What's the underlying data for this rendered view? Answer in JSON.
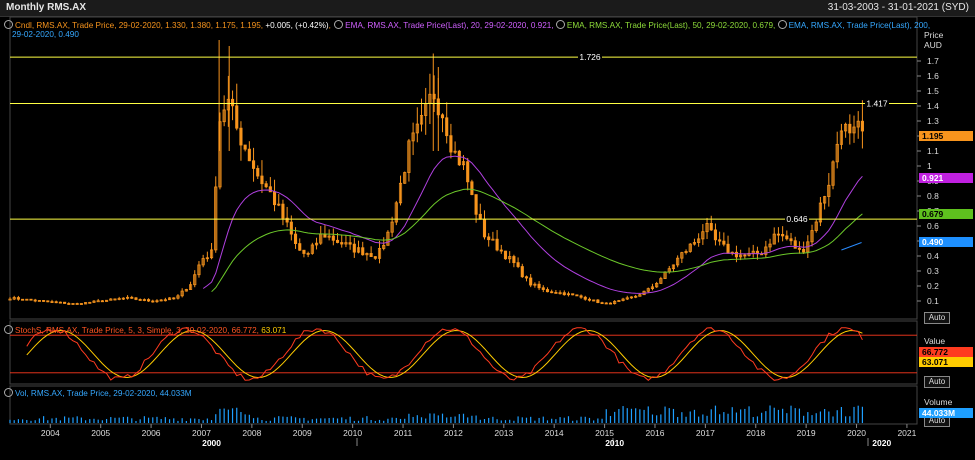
{
  "header": {
    "title": "Monthly RMS.AX",
    "date_range": "31-03-2003 - 31-01-2021 (SYD)"
  },
  "legends": {
    "cndl": {
      "icon": "gear-dot-icon",
      "parts": [
        {
          "text": "Cndl, RMS.AX, Trade Price, 29-02-2020, 1.330, 1.380, 1.175, 1.195, ",
          "color": "#f7941d"
        },
        {
          "text": "+0.005, (+0.42%)",
          "color": "#ffffff"
        },
        {
          "text": ", ",
          "color": "#f7941d"
        }
      ]
    },
    "ema20": {
      "text": "EMA, RMS.AX, Trade Price(Last),  20, 29-02-2020, 0.921, ",
      "color": "#d060ff"
    },
    "ema50": {
      "text": "EMA, RMS.AX, Trade Price(Last),  50, 29-02-2020, 0.679, ",
      "color": "#8edc3a"
    },
    "ema200_a": {
      "text": "EMA, RMS.AX, Trade Price(Last),  200,",
      "color": "#35a8ff"
    },
    "ema200_b": {
      "text": "29-02-2020, 0.490",
      "color": "#35a8ff"
    },
    "stoch": {
      "text": "StochS, RMS.AX, Trade Price,  5, 3, Simple, 3, 29-02-2020, 66.772, ",
      "color": "#ff5522",
      "value2": "63.071",
      "value2_color": "#ffcc00"
    },
    "vol": {
      "text": "Vol, RMS.AX, Trade Price, 29-02-2020, 44.033M",
      "color": "#35a8ff"
    }
  },
  "axes": {
    "price_head": "Price",
    "price_unit": "AUD",
    "stoch_head": "Value",
    "vol_head": "Volume",
    "auto": "Auto",
    "price_ticks": [
      "1.7",
      "1.6",
      "1.5",
      "1.4",
      "1.3",
      "1.2",
      "1.1",
      "1",
      "0.9",
      "0.8",
      "0.7",
      "0.6",
      "0.5",
      "0.4",
      "0.3",
      "0.2",
      "0.1"
    ],
    "years": [
      "2004",
      "2005",
      "2006",
      "2007",
      "2008",
      "2009",
      "2010",
      "2011",
      "2012",
      "2013",
      "2014",
      "2015",
      "2016",
      "2017",
      "2018",
      "2019",
      "2020",
      "2021"
    ],
    "decades": [
      "2000",
      "2010",
      "2020"
    ]
  },
  "tags": {
    "last_price": {
      "text": "1.195",
      "color": "#f7941d"
    },
    "ema20": {
      "text": "0.921",
      "color": "#c020e0"
    },
    "ema50": {
      "text": "0.679",
      "color": "#5ec01e"
    },
    "ema200": {
      "text": "0.490",
      "color": "#1e90ff"
    },
    "stoch_k": {
      "text": "66.772",
      "color": "#ff3b1f"
    },
    "stoch_d": {
      "text": "63.071",
      "color": "#ffcc00"
    },
    "volume": {
      "text": "44.033M",
      "color": "#1e9fff"
    }
  },
  "levels": [
    {
      "text": "1.726",
      "value": 1.726
    },
    {
      "text": "1.417",
      "value": 1.417
    },
    {
      "text": "0.646",
      "value": 0.646
    }
  ],
  "colors": {
    "candle": "#f7941d",
    "ema20": "#b040e0",
    "ema50": "#6cc82a",
    "ema200": "#2a8cff",
    "level": "#ffff44",
    "stoch_k": "#ff3b1f",
    "stoch_d": "#ffcc00",
    "vol": "#1e9fff"
  }
}
